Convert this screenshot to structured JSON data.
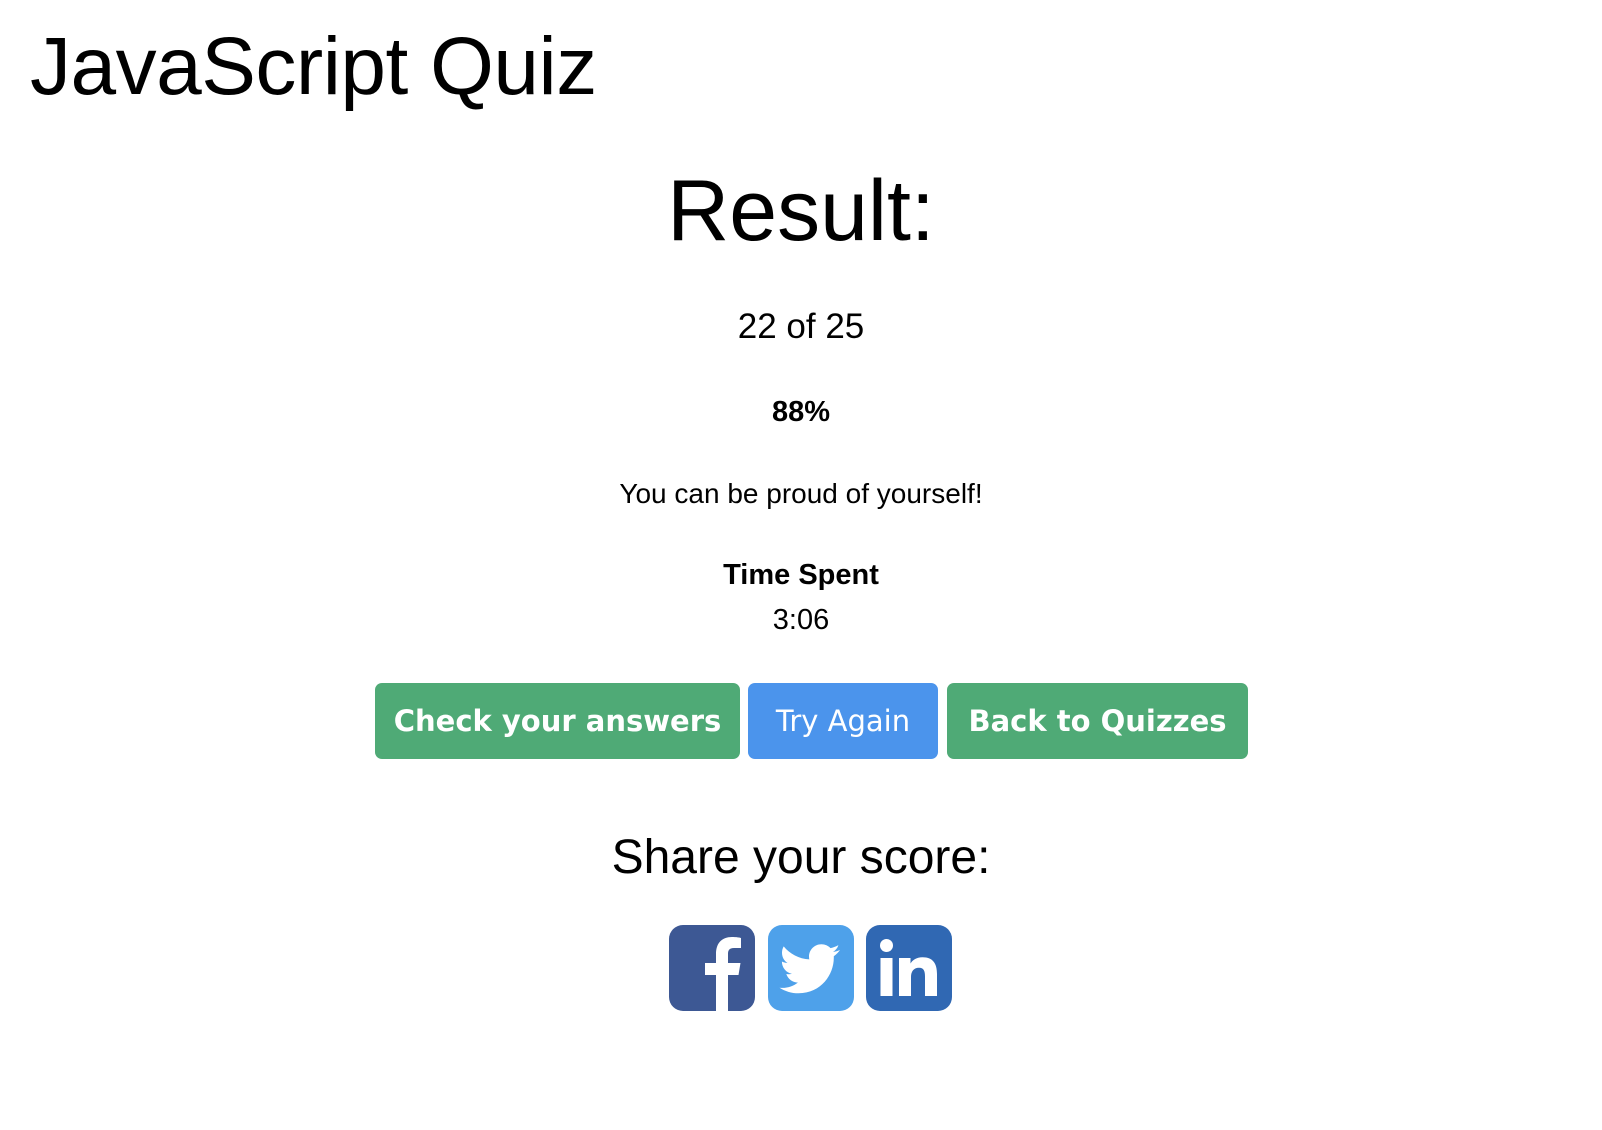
{
  "header": {
    "title": "JavaScript Quiz"
  },
  "result": {
    "heading": "Result:",
    "score": "22 of 25",
    "percent": "88%",
    "message": "You can be proud of yourself!",
    "time_label": "Time Spent",
    "time_value": "3:06"
  },
  "actions": {
    "check_label": "Check your answers",
    "try_again_label": "Try Again",
    "back_label": "Back to Quizzes"
  },
  "share": {
    "heading": "Share your score:",
    "icons": [
      "facebook-icon",
      "twitter-icon",
      "linkedin-icon"
    ]
  },
  "colors": {
    "green": "#4faa76",
    "blue": "#4b94ec",
    "facebook": "#3d5894",
    "twitter": "#4ea1ea",
    "linkedin": "#3068b3"
  }
}
